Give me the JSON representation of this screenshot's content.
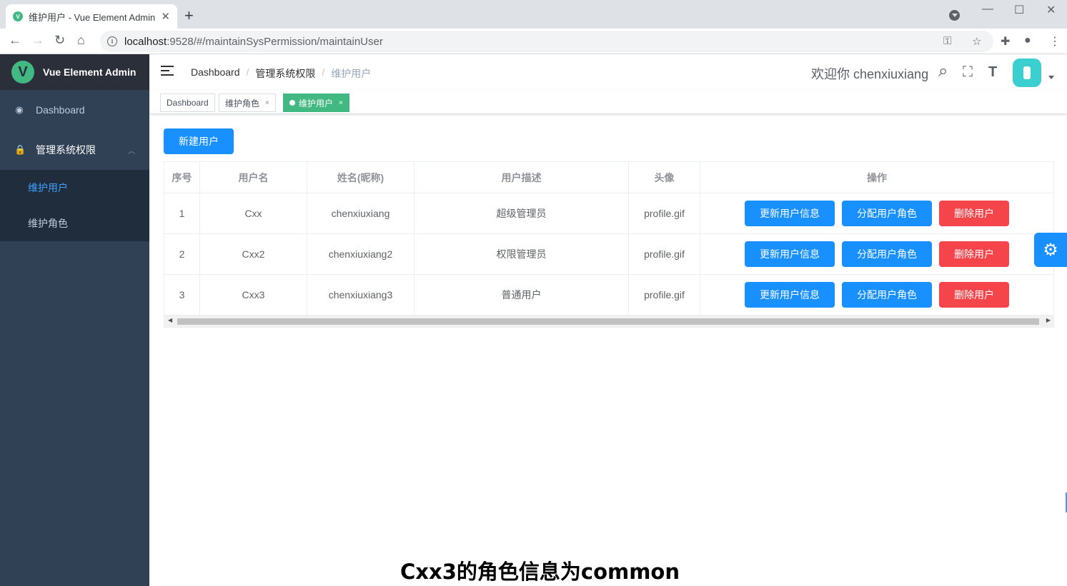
{
  "browser": {
    "tab_title": "维护用户 - Vue Element Admin",
    "tab_close": "✕",
    "new_tab": "+",
    "url_host": "localhost",
    "url_path": ":9528/#/maintainSysPermission/maintainUser",
    "min": "—",
    "max": "☐",
    "close": "✕",
    "back": "←",
    "forward": "→",
    "reload": "↻",
    "home": "⌂",
    "info": "i",
    "key_icon": "⚿",
    "star_icon": "☆",
    "puzzle_icon": "✚",
    "account_icon": "●",
    "more_icon": "⋮"
  },
  "sidebar": {
    "logo_mark": "V",
    "logo_text": "Vue Element Admin",
    "dashboard_icon": "◉",
    "dashboard": "Dashboard",
    "perm_icon": "🔒",
    "perm_label": "管理系统权限",
    "perm_chev": "︿",
    "sub_items": [
      "维护用户",
      "维护角色"
    ]
  },
  "navbar": {
    "breadcrumb": [
      "Dashboard",
      "管理系统权限",
      "维护用户"
    ],
    "sep": "/",
    "welcome": "欢迎你 chenxiuxiang",
    "search_icon": "⌕",
    "fullscreen_icon": "⛶",
    "size_icon": "T"
  },
  "tags": {
    "items": [
      "Dashboard",
      "维护角色",
      "维护用户"
    ],
    "close": "×"
  },
  "main": {
    "create_label": "新建用户",
    "headers": [
      "序号",
      "用户名",
      "姓名(昵称)",
      "用户描述",
      "头像",
      "操作"
    ],
    "rows": [
      {
        "id": "1",
        "username": "Cxx",
        "name": "chenxiuxiang",
        "desc": "超级管理员",
        "avatar": "profile.gif"
      },
      {
        "id": "2",
        "username": "Cxx2",
        "name": "chenxiuxiang2",
        "desc": "权限管理员",
        "avatar": "profile.gif"
      },
      {
        "id": "3",
        "username": "Cxx3",
        "name": "chenxiuxiang3",
        "desc": "普通用户",
        "avatar": "profile.gif"
      }
    ],
    "update_label": "更新用户信息",
    "assign_label": "分配用户角色",
    "delete_label": "删除用户",
    "scroll_left": "◀",
    "scroll_right": "▶",
    "settings_icon": "⚙"
  },
  "caption": "Cxx3的角色信息为common",
  "colors": {
    "primary": "#1890ff",
    "danger": "#f5454a",
    "tag_active": "#42b983",
    "sidebar": "#304156"
  }
}
